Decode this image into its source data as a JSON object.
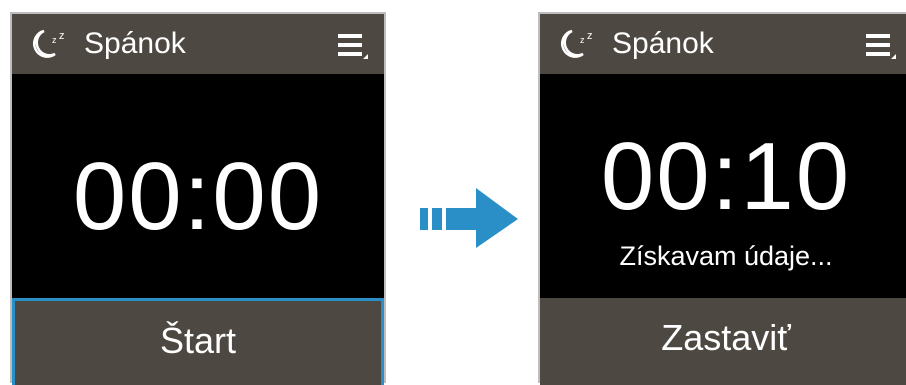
{
  "left_screen": {
    "title": "Spánok",
    "icons": {
      "app": "sleep-moon-icon",
      "menu": "menu-icon"
    },
    "timer": "00:00",
    "button_label": "Štart"
  },
  "right_screen": {
    "title": "Spánok",
    "icons": {
      "app": "sleep-moon-icon",
      "menu": "menu-icon"
    },
    "timer": "00:10",
    "status": "Získavam údaje...",
    "button_label": "Zastaviť"
  },
  "transition_icon": "arrow-right-icon",
  "colors": {
    "header_bg": "#4d4841",
    "screen_bg": "#000000",
    "highlight_border": "#2b8fc7",
    "arrow": "#2b8fc7"
  }
}
